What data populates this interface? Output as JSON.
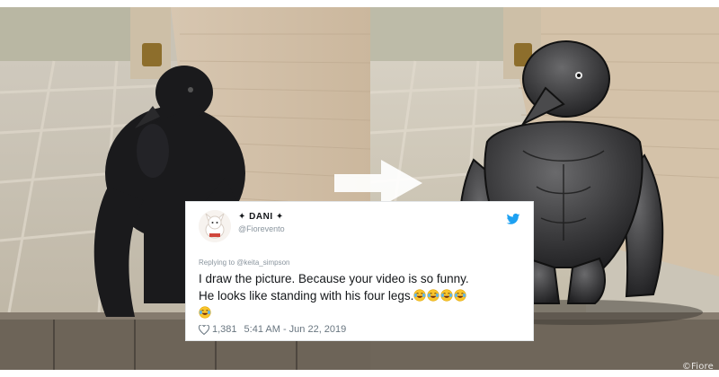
{
  "tweet": {
    "display_name": "✦ DANI ✦",
    "handle": "@Fiorevento",
    "reply_prefix": "Replying to ",
    "reply_target": "@keita_simpson",
    "text_line1": "I draw the picture. Because your video is so funny.",
    "text_line2": "He looks like standing with his four legs.",
    "emoji_count": 5,
    "likes": "1,381",
    "timestamp": "5:41 AM - Jun 22, 2019"
  },
  "watermark": "©Fiore",
  "colors": {
    "twitter_blue": "#1da1f2",
    "like_gray": "#697680"
  }
}
